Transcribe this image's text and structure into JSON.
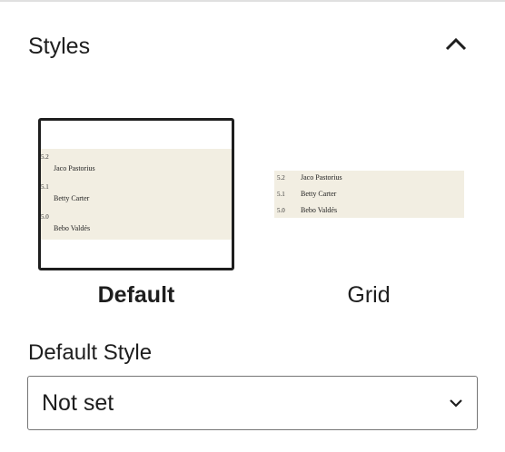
{
  "panel": {
    "title": "Styles"
  },
  "styles": {
    "options": [
      {
        "label": "Default",
        "selected": true,
        "preview": [
          {
            "number": "5.2",
            "name": "Jaco Pastorius"
          },
          {
            "number": "5.1",
            "name": "Betty Carter"
          },
          {
            "number": "5.0",
            "name": "Bebo Valdés"
          }
        ]
      },
      {
        "label": "Grid",
        "selected": false,
        "preview": [
          {
            "number": "5.2",
            "name": "Jaco Pastorius"
          },
          {
            "number": "5.1",
            "name": "Betty Carter"
          },
          {
            "number": "5.0",
            "name": "Bebo Valdés"
          }
        ]
      }
    ]
  },
  "default_style": {
    "label": "Default Style",
    "value": "Not set"
  },
  "colors": {
    "preview_background": "#f2eee2",
    "selected_border": "#1e1e1e",
    "select_border": "#757575"
  },
  "icons": {
    "collapse": "chevron-up-icon",
    "dropdown": "chevron-down-icon"
  }
}
